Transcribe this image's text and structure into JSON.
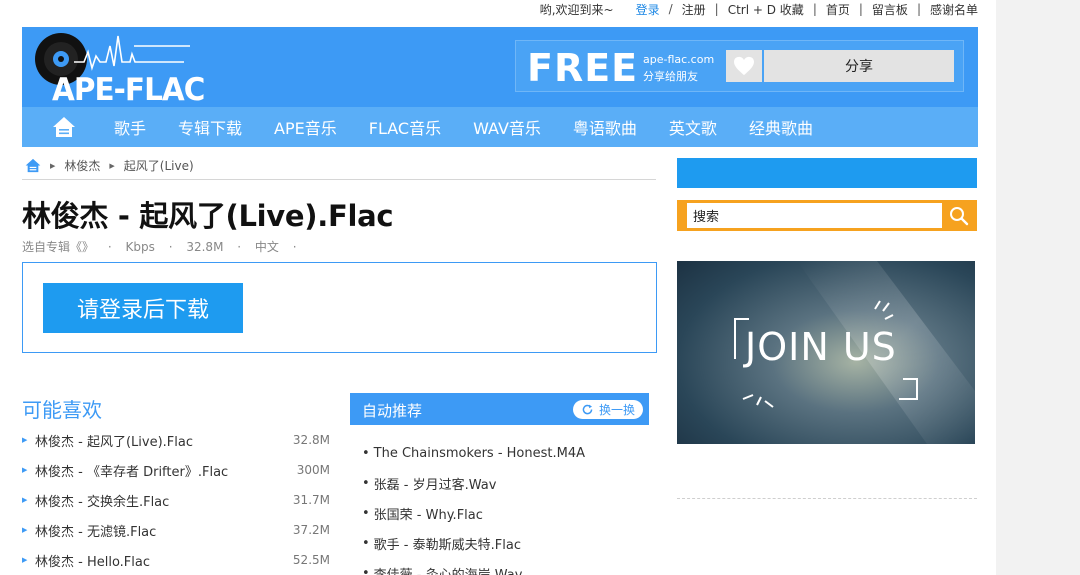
{
  "topbar": {
    "welcome": "哟,欢迎到来~",
    "login": "登录",
    "slash": "/",
    "register": "注册",
    "bookmark": "Ctrl + D 收藏",
    "home": "首页",
    "guestbook": "留言板",
    "thanks": "感谢名单",
    "divider": "|"
  },
  "header": {
    "logo_text": "APE-FLAC",
    "promo_free": "FREE",
    "promo_site": "ape-flac.com",
    "promo_share_text": "分享给朋友",
    "share_button": "分享"
  },
  "nav": {
    "items": [
      "歌手",
      "专辑下载",
      "APE音乐",
      "FLAC音乐",
      "WAV音乐",
      "粤语歌曲",
      "英文歌",
      "经典歌曲"
    ]
  },
  "breadcrumb": {
    "artist": "林俊杰",
    "song": "起风了(Live)"
  },
  "song": {
    "title": "林俊杰 - 起风了(Live).Flac",
    "album_prefix": "选自专辑《》",
    "dot": "·",
    "bitrate": "Kbps",
    "size": "32.8M",
    "language": "中文"
  },
  "download_button": "请登录后下载",
  "like": {
    "title": "可能喜欢",
    "items": [
      {
        "name": "林俊杰 - 起风了(Live).Flac",
        "size": "32.8M"
      },
      {
        "name": "林俊杰 - 《幸存者 Drifter》.Flac",
        "size": "300M"
      },
      {
        "name": "林俊杰 - 交换余生.Flac",
        "size": "31.7M"
      },
      {
        "name": "林俊杰 - 无滤镜.Flac",
        "size": "37.2M"
      },
      {
        "name": "林俊杰 - Hello.Flac",
        "size": "52.5M"
      }
    ]
  },
  "recommend": {
    "title": "自动推荐",
    "swap": "换一换",
    "bullet": "•",
    "items": [
      "The Chainsmokers - Honest.M4A",
      "张磊 - 岁月过客.Wav",
      "张国荣 - Why.Flac",
      "歌手 - 泰勒斯威夫特.Flac",
      "李佳薇 - 灸心的海岸.Wav"
    ]
  },
  "sidebar": {
    "search_value": "搜索",
    "join_text": "JOIN US"
  },
  "colors": {
    "primary": "#3d9af5",
    "nav": "#5aaef7",
    "accent_blue": "#1e9bf0",
    "search_orange": "#f6a21f"
  }
}
